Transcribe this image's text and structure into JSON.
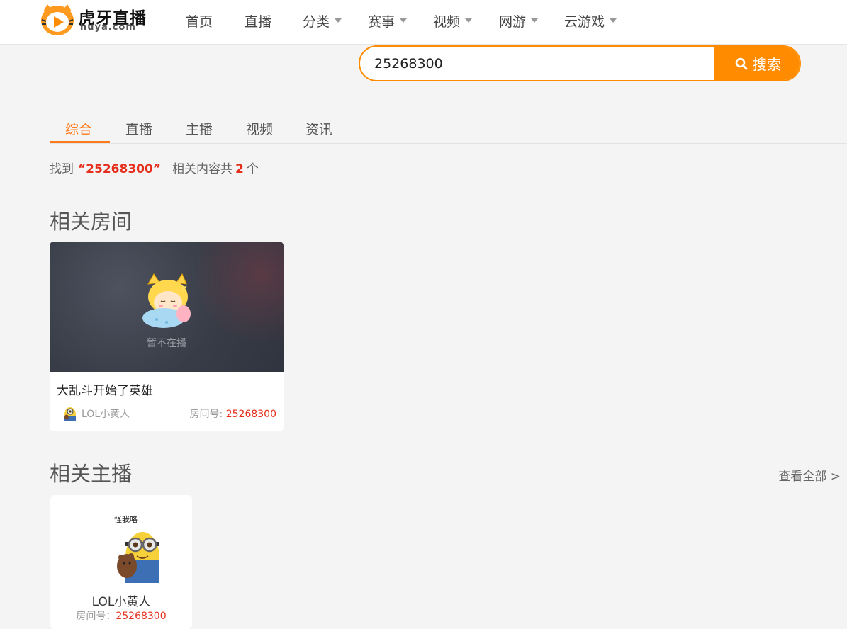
{
  "brand": {
    "name": "虎牙直播",
    "domain": "huya.com",
    "accent": "#ff8c00"
  },
  "nav": {
    "items": [
      {
        "label": "首页",
        "has_dropdown": false
      },
      {
        "label": "直播",
        "has_dropdown": false
      },
      {
        "label": "分类",
        "has_dropdown": true
      },
      {
        "label": "赛事",
        "has_dropdown": true
      },
      {
        "label": "视频",
        "has_dropdown": true
      },
      {
        "label": "网游",
        "has_dropdown": true
      },
      {
        "label": "云游戏",
        "has_dropdown": true
      }
    ]
  },
  "search": {
    "value": "25268300",
    "button_label": "搜索"
  },
  "tabs": {
    "items": [
      {
        "label": "综合",
        "active": true
      },
      {
        "label": "直播",
        "active": false
      },
      {
        "label": "主播",
        "active": false
      },
      {
        "label": "视频",
        "active": false
      },
      {
        "label": "资讯",
        "active": false
      }
    ]
  },
  "result": {
    "prefix": "找到",
    "keyword": "“25268300”",
    "middle": "相关内容共",
    "count": "2",
    "suffix": "个"
  },
  "rooms_section": {
    "title": "相关房间",
    "rooms": [
      {
        "status_text": "暂不在播",
        "title": "大乱斗开始了英雄",
        "host": "LOL小黄人",
        "room_no_label": "房间号:",
        "room_no": "25268300"
      }
    ]
  },
  "anchors_section": {
    "title": "相关主播",
    "view_all": "查看全部 >",
    "anchors": [
      {
        "avatar_caption": "怪我咯",
        "name": "LOL小黄人",
        "room_no_label": "房间号：",
        "room_no": "25268300"
      }
    ]
  },
  "colors": {
    "accent": "#ff8c00",
    "tab_active": "#ff7a1a",
    "highlight": "#e52e1c",
    "page_bg": "#f4f4f4"
  }
}
